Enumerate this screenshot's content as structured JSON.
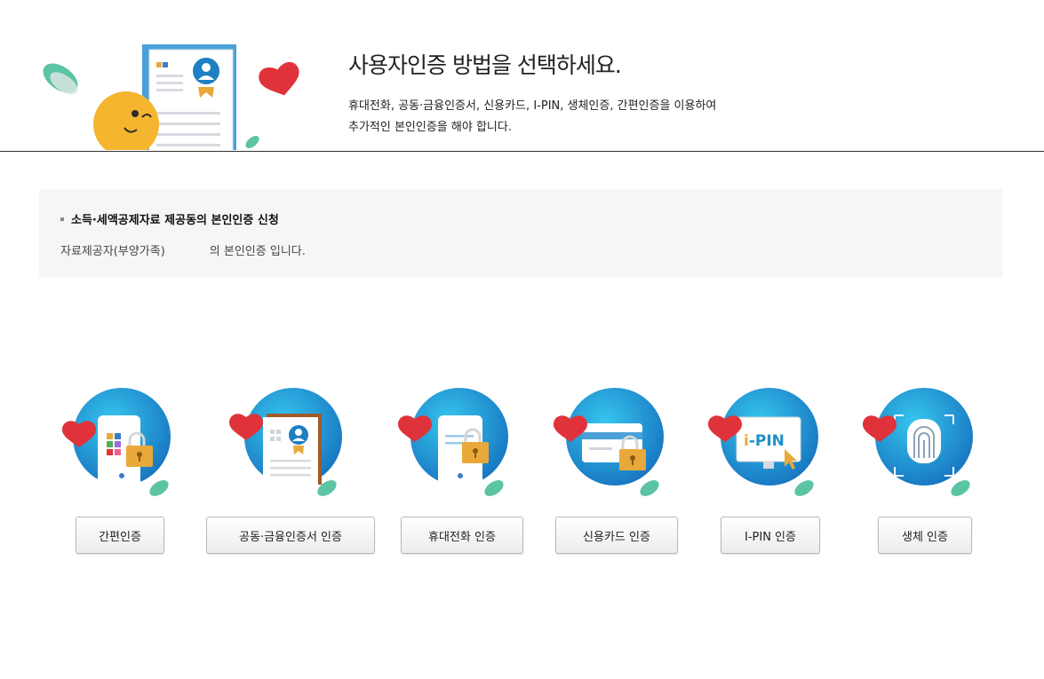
{
  "header": {
    "title": "사용자인증 방법을 선택하세요.",
    "desc_line1": "휴대전화, 공동·금융인증서, 신용카드, I-PIN, 생체인증, 간편인증을 이용하여",
    "desc_line2": "추가적인 본인인증을 해야 합니다."
  },
  "info": {
    "title": "소득·세액공제자료 제공동의 본인인증 신청",
    "text_prefix": "자료제공자(부양가족)",
    "text_suffix": "의 본인인증 입니다."
  },
  "methods": [
    {
      "label": "간편인증",
      "icon": "phone-app-lock-icon"
    },
    {
      "label": "공동·금융인증서 인증",
      "icon": "certificate-icon"
    },
    {
      "label": "휴대전화 인증",
      "icon": "mobile-phone-lock-icon"
    },
    {
      "label": "신용카드 인증",
      "icon": "credit-card-lock-icon"
    },
    {
      "label": "I-PIN 인증",
      "icon": "ipin-monitor-icon"
    },
    {
      "label": "생체 인증",
      "icon": "fingerprint-icon"
    }
  ],
  "icon_text": {
    "ipin_label": "i-PIN"
  },
  "colors": {
    "accent_blue": "#1e90c8",
    "heart_red": "#e0323a",
    "leaf_green": "#5cc4a4",
    "lock_gold": "#e8a93a"
  }
}
